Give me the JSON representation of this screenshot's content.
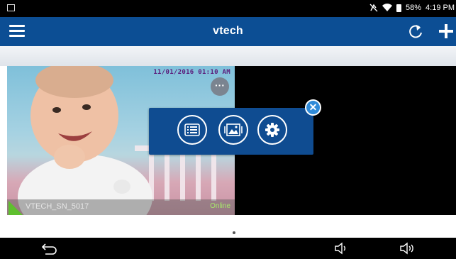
{
  "status_bar": {
    "battery": "58%",
    "time": "4:19 PM",
    "icons": [
      "notification-icon",
      "mute-icon",
      "wifi-icon",
      "battery-icon"
    ]
  },
  "app_bar": {
    "title": "vtech",
    "icons": [
      "menu-icon",
      "refresh-icon",
      "add-icon"
    ]
  },
  "camera": {
    "timestamp": "11/01/2016 01:10 AM",
    "name": "VTECH_SN_5017",
    "status": "Online",
    "more_label": "···"
  },
  "popup": {
    "buttons": [
      "event-list-icon",
      "gallery-icon",
      "settings-icon"
    ],
    "close_label": "✕"
  },
  "nav_bar": {
    "icons": [
      "back-icon",
      "volume-down-icon",
      "volume-up-icon"
    ]
  },
  "colors": {
    "app_bar": "#0c4e94",
    "popup": "#0f4c91",
    "close_button": "#2f8ad8",
    "online": "#a6e86a",
    "signal": "#5fbf2f"
  }
}
